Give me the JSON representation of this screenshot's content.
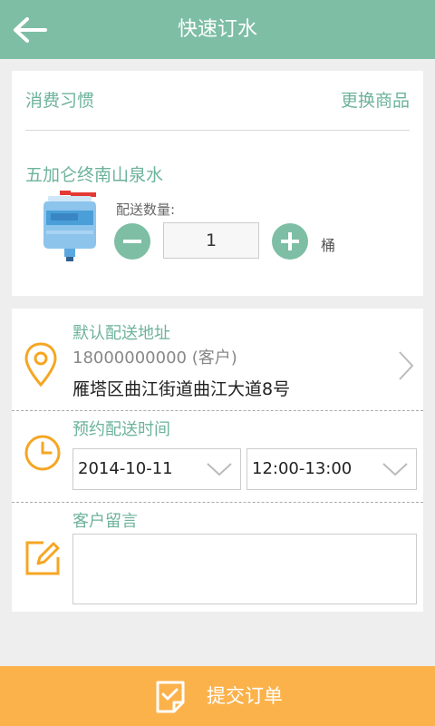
{
  "header": {
    "title": "快速订水"
  },
  "product_card": {
    "habit_label": "消费习惯",
    "change_label": "更换商品",
    "product_name": "五加仑终南山泉水",
    "quantity_label": "配送数量:",
    "quantity_value": "1",
    "unit": "桶"
  },
  "delivery": {
    "address_title": "默认配送地址",
    "phone": "18000000000 (客户)",
    "address": "雁塔区曲江街道曲江大道8号",
    "time_title": "预约配送时间",
    "date_value": "2014-10-11",
    "time_value": "12:00-13:00",
    "message_title": "客户留言",
    "message_value": ""
  },
  "footer": {
    "submit_label": "提交订单"
  },
  "colors": {
    "primary": "#7dbea4",
    "accent": "#fbb24b",
    "icon_orange": "#f5a623"
  }
}
